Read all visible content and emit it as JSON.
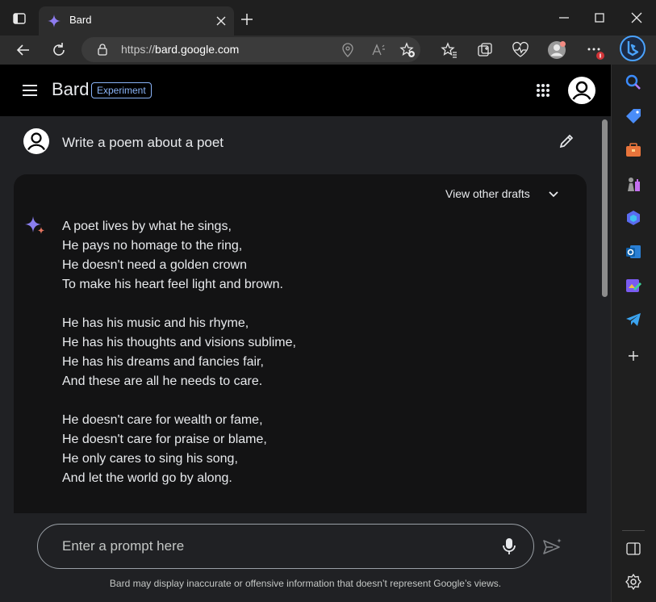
{
  "browser": {
    "tab": {
      "title": "Bard"
    },
    "url": {
      "prefix": "https://",
      "domain": "bard.google.com"
    },
    "colors": {
      "chrome": "#1f1f1f",
      "toolbar": "#2d2d2d",
      "accent": "#8ab4f8"
    }
  },
  "bard": {
    "brand": "Bard",
    "badge": "Experiment",
    "query": "Write a poem about a poet",
    "drafts_label": "View other drafts",
    "poem": [
      [
        "A poet lives by what he sings,",
        "He pays no homage to the ring,",
        "He doesn't need a golden crown",
        "To make his heart feel light and brown."
      ],
      [
        "He has his music and his rhyme,",
        "He has his thoughts and visions sublime,",
        "He has his dreams and fancies fair,",
        "And these are all he needs to care."
      ],
      [
        "He doesn't care for wealth or fame,",
        "He doesn't care for praise or blame,",
        "He only cares to sing his song,",
        "And let the world go by along."
      ]
    ],
    "prompt_placeholder": "Enter a prompt here",
    "disclaimer": "Bard may display inaccurate or offensive information that doesn’t represent Google’s views."
  },
  "icons": {
    "edge_sidebar": [
      "search-icon",
      "shopping-tag-icon",
      "tools-briefcase-icon",
      "games-icon",
      "microsoft-365-icon",
      "outlook-icon",
      "image-designer-icon",
      "telegram-icon",
      "add-icon",
      "sidebar-toggle-icon",
      "settings-gear-icon"
    ]
  }
}
